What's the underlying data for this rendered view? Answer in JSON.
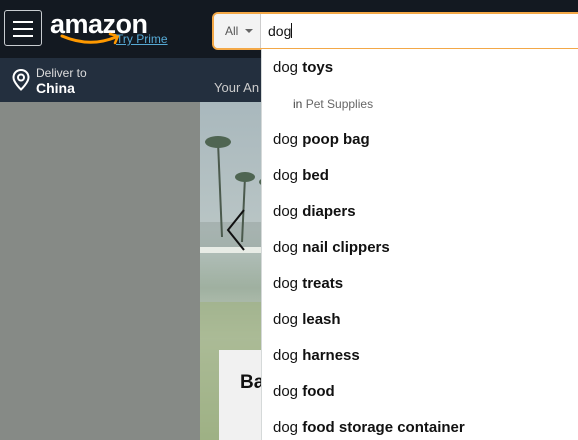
{
  "header": {
    "logo_text": "amazon",
    "try_prime": "Try Prime",
    "search": {
      "department": "All",
      "query": "dog"
    },
    "deliver_label": "Deliver to",
    "deliver_location": "China",
    "your_account_partial": "Your An"
  },
  "suggestions": [
    {
      "prefix": "dog",
      "bold": "toys"
    },
    {
      "in_label": "in",
      "category": "Pet Supplies"
    },
    {
      "prefix": "dog",
      "bold": "poop bag"
    },
    {
      "prefix": "dog",
      "bold": "bed"
    },
    {
      "prefix": "dog",
      "bold": "diapers"
    },
    {
      "prefix": "dog",
      "bold": "nail clippers"
    },
    {
      "prefix": "dog",
      "bold": "treats"
    },
    {
      "prefix": "dog",
      "bold": "leash"
    },
    {
      "prefix": "dog",
      "bold": "harness"
    },
    {
      "prefix": "dog",
      "bold": "food"
    },
    {
      "prefix": "dog",
      "bold": "food storage container"
    }
  ],
  "hero": {
    "card_text_partial": "Ba"
  },
  "colors": {
    "nav_bg": "#131921",
    "subnav_bg": "#232f3e",
    "search_focus": "#f3a847",
    "logo_smile": "#ff9900",
    "prime_link": "#56a9d4"
  },
  "icons": [
    "menu-icon",
    "location-pin-icon",
    "caret-down-icon",
    "chevron-left-icon"
  ]
}
